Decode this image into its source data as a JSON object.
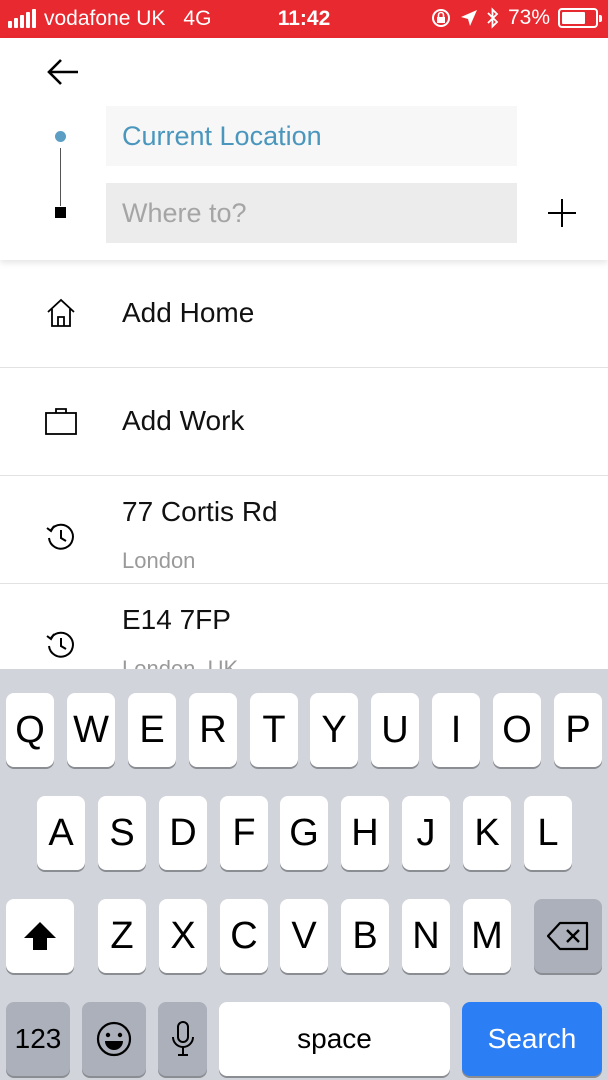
{
  "status_bar": {
    "carrier": "vodafone UK",
    "network": "4G",
    "time": "11:42",
    "battery_percent": "73%",
    "battery_level": 0.73,
    "background_color": "#e8292f"
  },
  "header": {
    "back_icon": "arrow-left-icon",
    "pickup_value": "Current Location",
    "destination_placeholder": "Where to?",
    "add_stop_icon": "plus-icon",
    "pickup_color": "#4a96bd"
  },
  "saved_places": [
    {
      "icon": "home-icon",
      "label": "Add Home"
    },
    {
      "icon": "briefcase-icon",
      "label": "Add Work"
    }
  ],
  "recent_places": [
    {
      "icon": "history-icon",
      "title": "77 Cortis Rd",
      "subtitle": "London"
    },
    {
      "icon": "history-icon",
      "title": "E14 7FP",
      "subtitle": "London, UK"
    }
  ],
  "keyboard": {
    "row1": [
      "Q",
      "W",
      "E",
      "R",
      "T",
      "Y",
      "U",
      "I",
      "O",
      "P"
    ],
    "row2": [
      "A",
      "S",
      "D",
      "F",
      "G",
      "H",
      "J",
      "K",
      "L"
    ],
    "row3": [
      "Z",
      "X",
      "C",
      "V",
      "B",
      "N",
      "M"
    ],
    "numbers_label": "123",
    "space_label": "space",
    "action_label": "Search",
    "shift_icon": "shift-icon",
    "delete_icon": "backspace-icon",
    "emoji_icon": "emoji-icon",
    "mic_icon": "microphone-icon",
    "action_color": "#2c7ef5"
  }
}
